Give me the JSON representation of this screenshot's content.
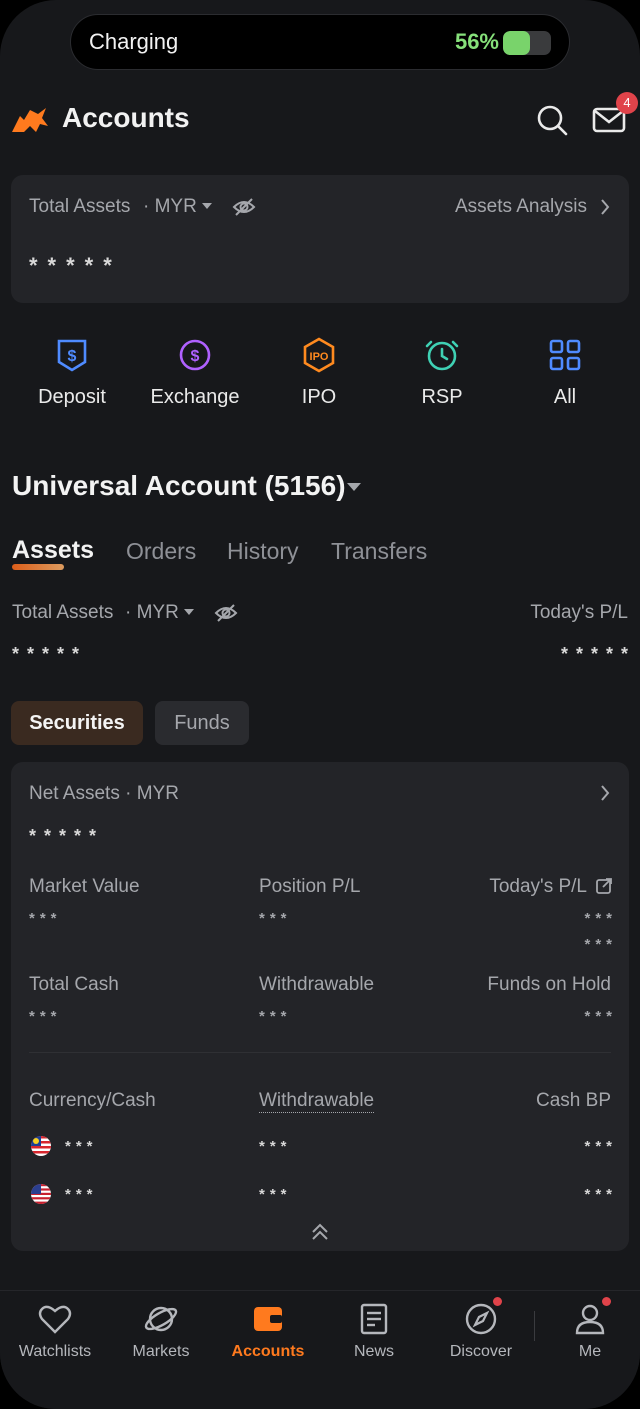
{
  "status_bar": {
    "left_text": "Charging",
    "battery_text": "56%",
    "battery_level": 0.56
  },
  "header": {
    "title": "Accounts",
    "mail_badge": "4"
  },
  "overview": {
    "total_assets_label": "Total Assets",
    "currency": "· MYR",
    "analysis_link": "Assets Analysis",
    "masked_value": "*****"
  },
  "quick_actions": [
    {
      "label": "Deposit",
      "icon": "deposit-icon"
    },
    {
      "label": "Exchange",
      "icon": "exchange-icon"
    },
    {
      "label": "IPO",
      "icon": "ipo-icon"
    },
    {
      "label": "RSP",
      "icon": "rsp-icon"
    },
    {
      "label": "All",
      "icon": "grid-icon"
    }
  ],
  "account": {
    "name": "Universal Account (5156)"
  },
  "tabs": [
    "Assets",
    "Orders",
    "History",
    "Transfers"
  ],
  "assets_summary": {
    "total_assets_label": "Total Assets",
    "currency": "· MYR",
    "todays_pl_label": "Today's P/L",
    "masked_value": "*****"
  },
  "asset_types": [
    "Securities",
    "Funds"
  ],
  "securities": {
    "net_assets_label": "Net Assets · MYR",
    "masked_value": "*****",
    "masked_small": "***",
    "metrics": [
      {
        "label": "Market Value"
      },
      {
        "label": "Position P/L"
      },
      {
        "label": "Today's P/L"
      },
      {
        "label": "Total Cash"
      },
      {
        "label": "Withdrawable"
      },
      {
        "label": "Funds on Hold"
      }
    ],
    "cash_table": {
      "headers": [
        "Currency/Cash",
        "Withdrawable",
        "Cash BP"
      ],
      "rows": [
        {
          "flag": "malaysia-flag",
          "cash": "***",
          "withdrawable": "***",
          "cash_bp": "***"
        },
        {
          "flag": "us-flag",
          "cash": "***",
          "withdrawable": "***",
          "cash_bp": "***"
        }
      ]
    }
  },
  "bottom_nav": [
    {
      "label": "Watchlists",
      "icon": "heart-icon"
    },
    {
      "label": "Markets",
      "icon": "planet-icon"
    },
    {
      "label": "Accounts",
      "icon": "wallet-icon"
    },
    {
      "label": "News",
      "icon": "news-icon"
    },
    {
      "label": "Discover",
      "icon": "compass-icon"
    },
    {
      "label": "Me",
      "icon": "profile-icon"
    }
  ],
  "colors": {
    "accent": "#ff7a1e",
    "background": "#17181b",
    "card": "#232428",
    "positive": "#86e07a",
    "badge": "#e0434a"
  }
}
